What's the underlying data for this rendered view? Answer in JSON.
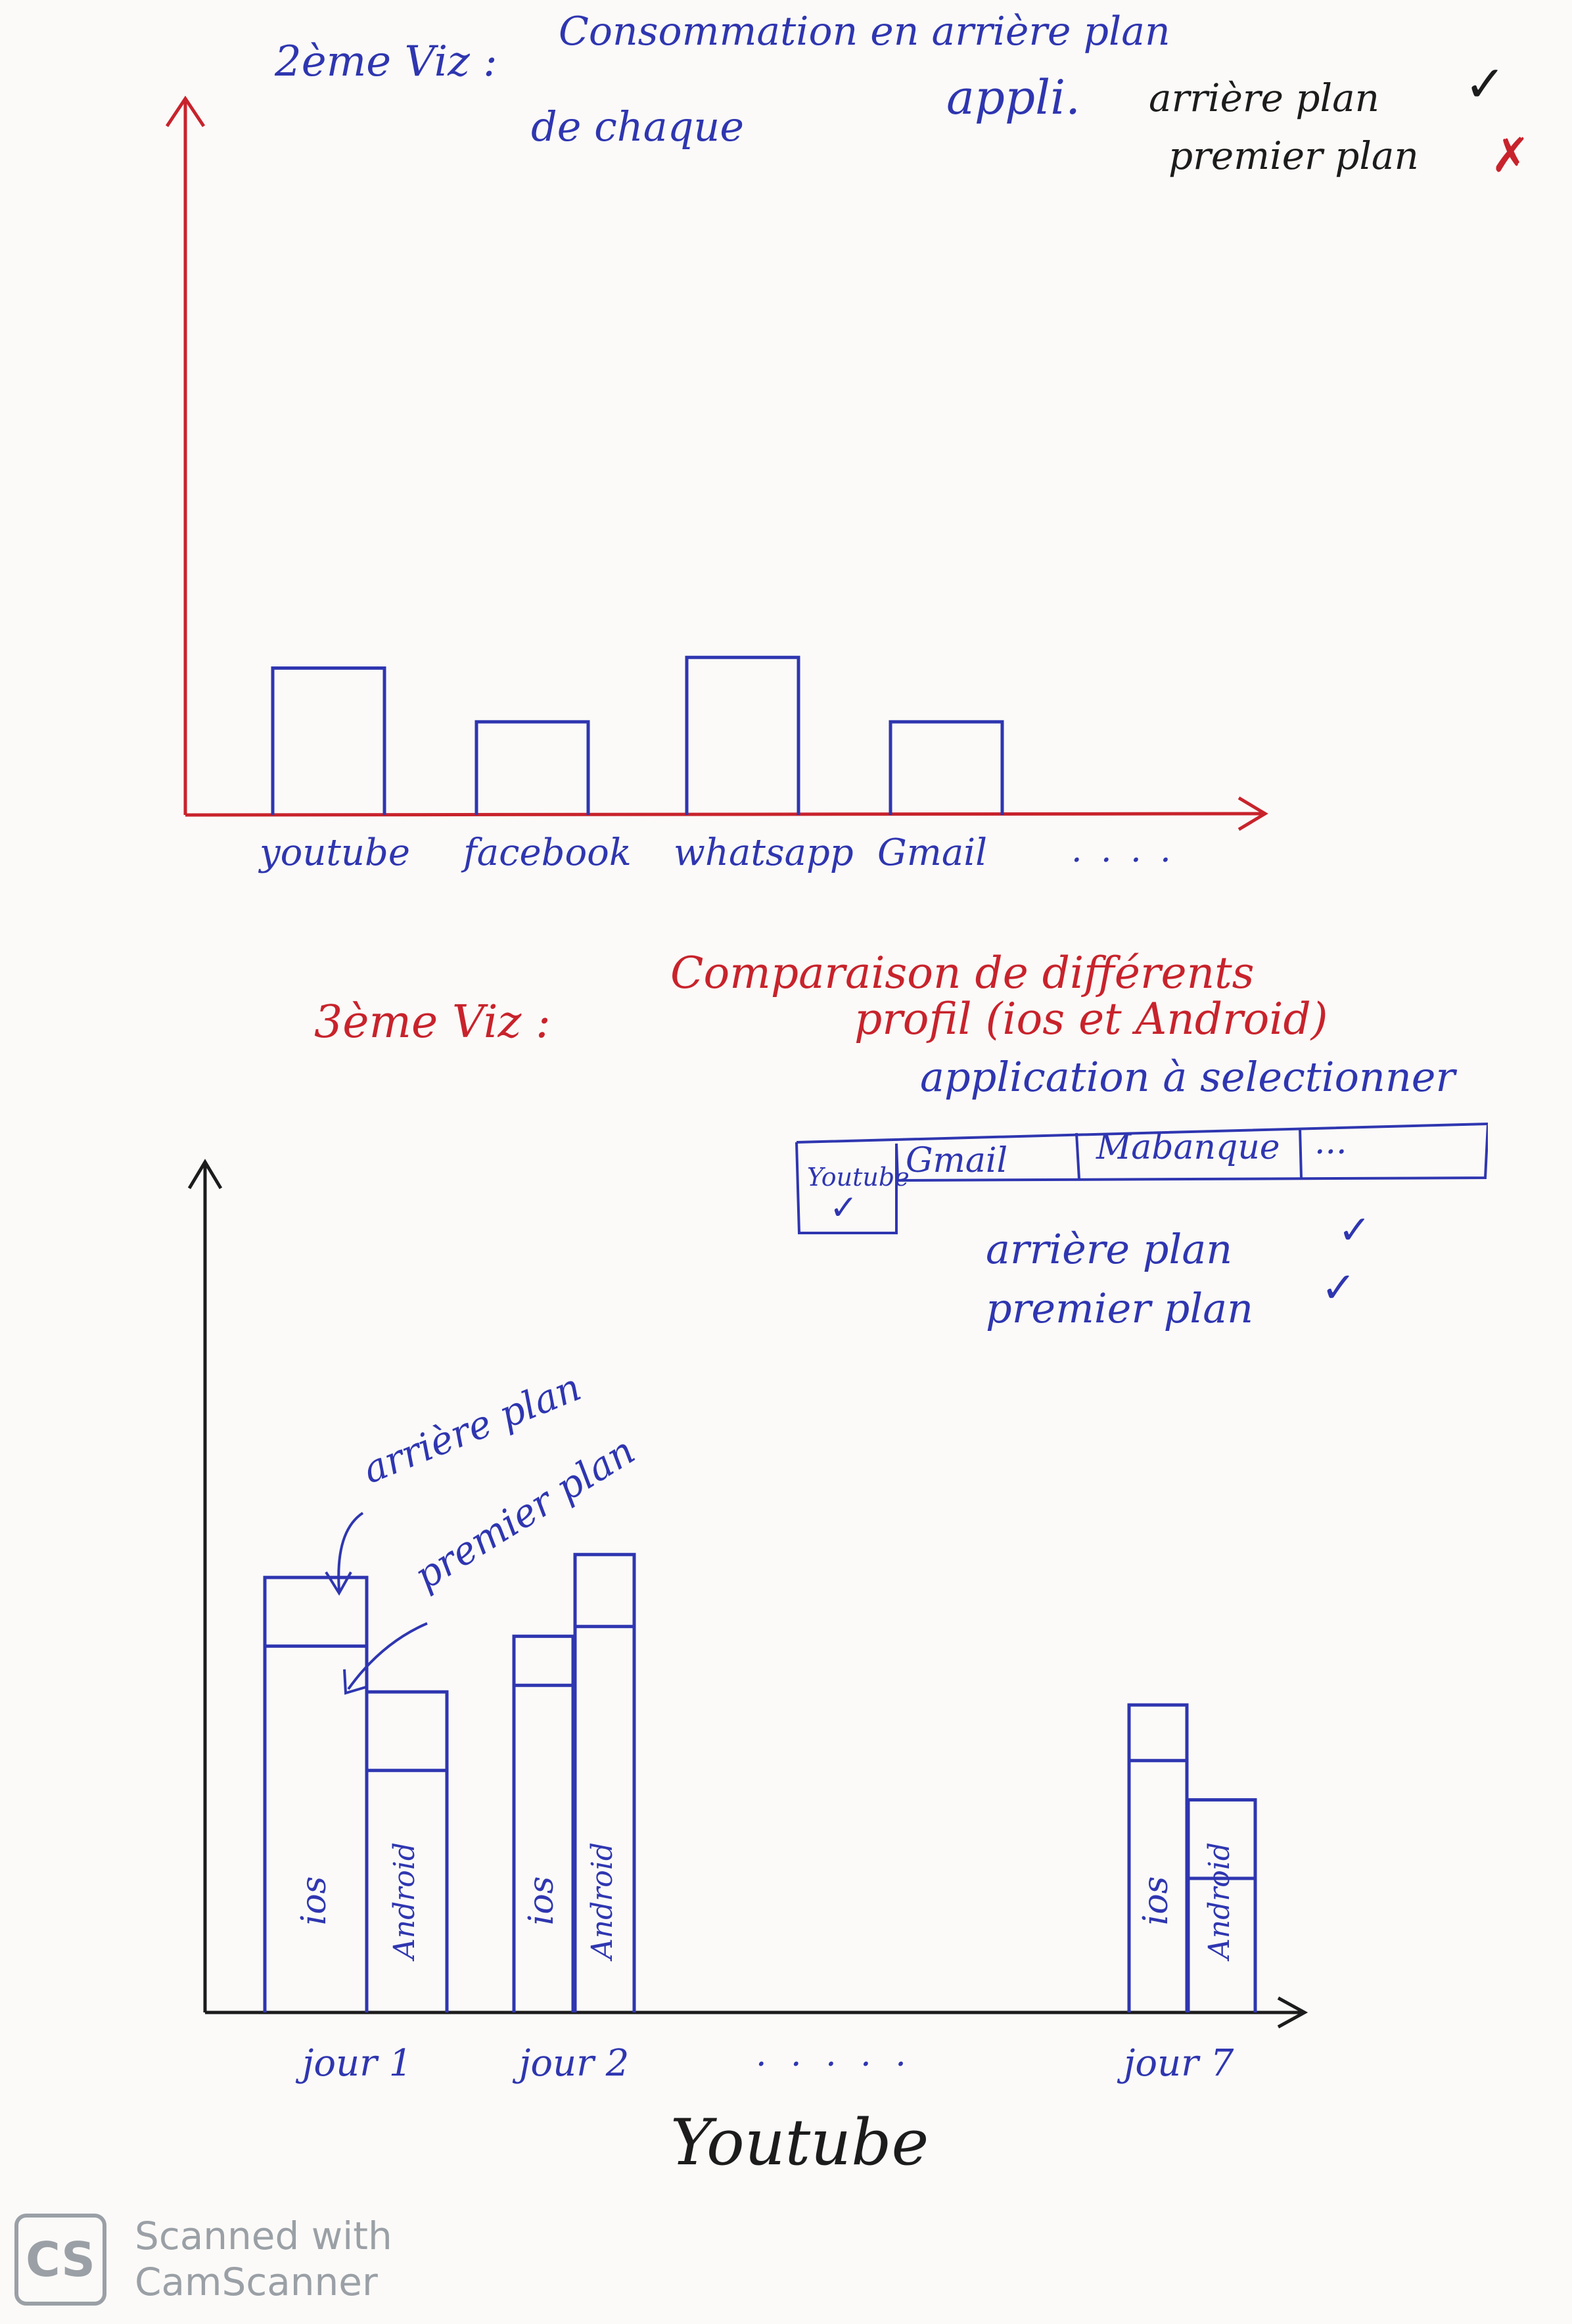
{
  "viz2": {
    "header_prefix": "2ème Viz :",
    "title_line1": "Consommation en arrière plan",
    "title_line2a": "de chaque",
    "title_line2b": "appli.",
    "option_background": "arrière plan",
    "option_foreground": "premier plan",
    "mark_background": "✓",
    "mark_foreground": "✗",
    "ellipsis": ". . . .",
    "chart_data": {
      "type": "bar",
      "categories": [
        "youtube",
        "facebook",
        "whatsapp",
        "Gmail"
      ],
      "values": [
        4.1,
        2.6,
        4.4,
        2.6
      ],
      "ylim": [
        0,
        20
      ],
      "axis_color": "#c8232c",
      "bar_color": "#2f36b0"
    }
  },
  "viz3": {
    "header_prefix": "3ème Viz :",
    "title_line1": "Comparaison de différents",
    "title_line2": "profil (ios et Android)",
    "app_select_label": "application à selectionner",
    "app_tabs": [
      "Youtube",
      "Gmail",
      "Mabanque",
      "..."
    ],
    "selected_tab_mark": "✓",
    "option_background": "arrière plan",
    "option_foreground": "premier plan",
    "mark_background": "✓",
    "mark_foreground": "✓",
    "annotation_background": "arrière plan",
    "annotation_foreground": "premier plan",
    "ellipsis": ". . . . .",
    "caption": "Youtube",
    "chart_data": {
      "type": "bar",
      "categories": [
        "jour 1",
        "jour 2",
        "jour 7"
      ],
      "series": [
        {
          "name": "ios",
          "foreground": [
            11.2,
            10.0,
            7.7
          ],
          "background": [
            2.1,
            1.5,
            1.7
          ]
        },
        {
          "name": "Android",
          "foreground": [
            7.4,
            11.8,
            4.1
          ],
          "background": [
            2.4,
            2.2,
            2.4
          ]
        }
      ],
      "ylim": [
        0,
        26
      ],
      "axis_color": "#1c1c1c",
      "bar_color": "#2f36b0"
    }
  },
  "watermark": {
    "logo": "CS",
    "line1": "Scanned with",
    "line2": "CamScanner"
  }
}
